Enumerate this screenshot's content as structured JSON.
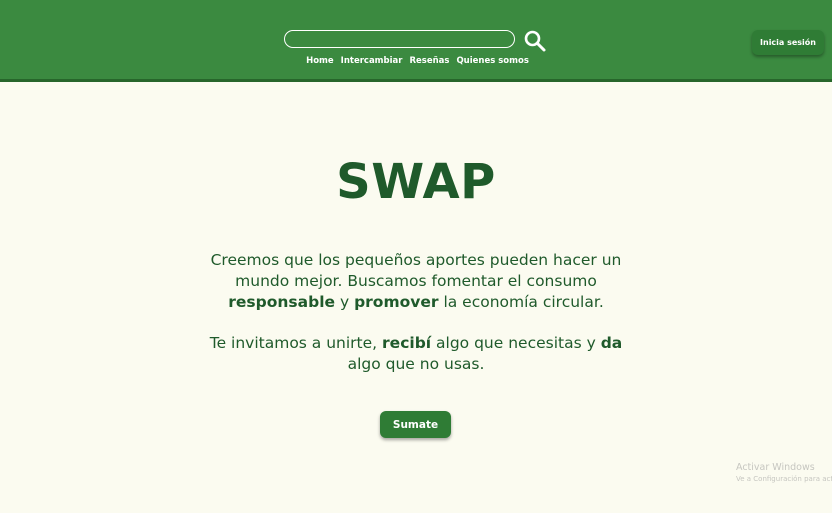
{
  "header": {
    "search": {
      "value": "",
      "placeholder": ""
    },
    "nav": [
      "Home",
      "Intercambiar",
      "Reseñas",
      "Quienes somos"
    ],
    "login_label": "Inicia sesión"
  },
  "hero": {
    "title": "SWAP",
    "p1": [
      "Creemos que los pequeños aportes pueden hacer un mundo mejor. Buscamos fomentar el consumo ",
      "responsable",
      " y ",
      "promover",
      " la economía circular."
    ],
    "p2": [
      "Te invitamos a unirte, ",
      "recibí",
      " algo que necesitas y ",
      "da",
      " algo que no usas."
    ],
    "cta_label": "Sumate"
  },
  "watermark": {
    "line1": "Activar Windows",
    "line2": "Ve a Configuración para activar Windows."
  },
  "colors": {
    "header_bg": "#3b8a40",
    "page_bg": "#fbfbf0",
    "text_green": "#1f5a2b",
    "button_bg": "#2f7c35"
  }
}
